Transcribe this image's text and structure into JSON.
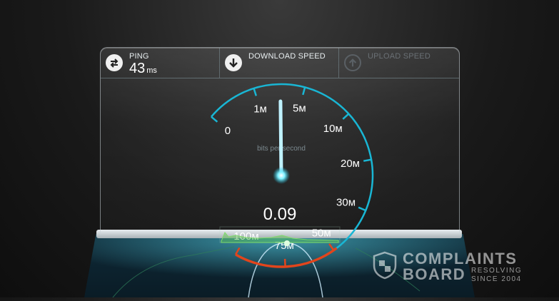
{
  "tabs": {
    "ping": {
      "label": "PING",
      "value": "43",
      "unit": "ms",
      "icon": "ping-arrows-icon"
    },
    "download": {
      "label": "DOWNLOAD SPEED",
      "icon": "download-arrow-icon"
    },
    "upload": {
      "label": "UPLOAD SPEED",
      "icon": "upload-arrow-icon"
    }
  },
  "gauge": {
    "caption": "bits per second",
    "reading": "0.09",
    "ticks": [
      {
        "label": "0"
      },
      {
        "label": "1м"
      },
      {
        "label": "5м"
      },
      {
        "label": "10м"
      },
      {
        "label": "20м"
      },
      {
        "label": "30м"
      },
      {
        "label": "50м"
      },
      {
        "label": "75м"
      },
      {
        "label": "100м"
      }
    ],
    "needle_position_fraction": 0.19,
    "colors": {
      "arc": "#19b6d4",
      "hot_arc": "#e2451c",
      "needle": "#bff2ff"
    }
  },
  "watermark": {
    "line1": "COMPLAINTS",
    "line2": "BOARD",
    "tagline1": "RESOLVING",
    "tagline2": "SINCE 2004"
  }
}
